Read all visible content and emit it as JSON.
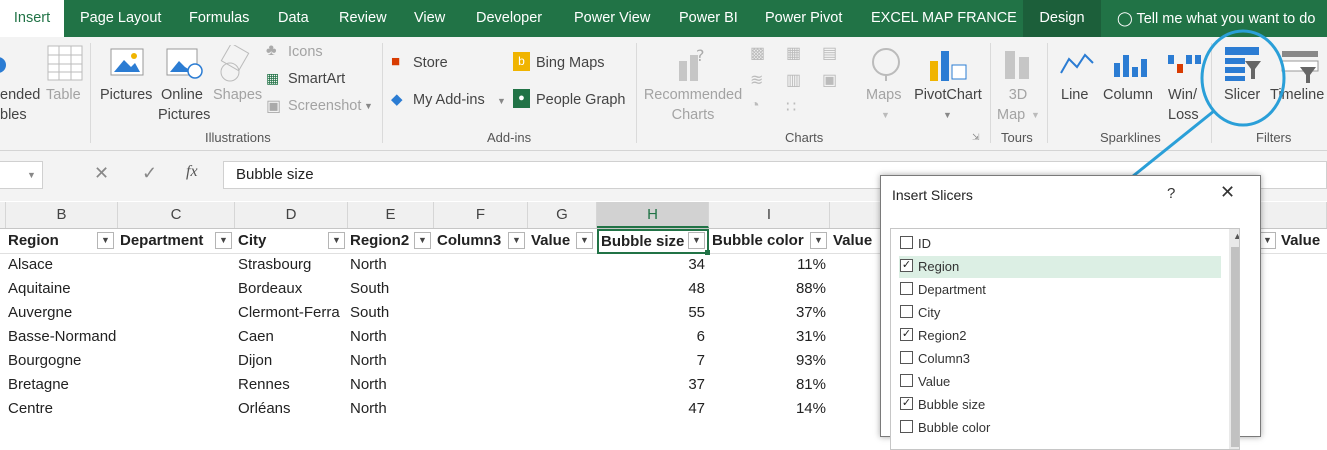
{
  "tabs": [
    "Insert",
    "Page Layout",
    "Formulas",
    "Data",
    "Review",
    "View",
    "Developer",
    "Power View",
    "Power BI",
    "Power Pivot",
    "EXCEL MAP FRANCE",
    "Design"
  ],
  "tell_me": "Tell me what you want to do",
  "ribbon": {
    "tables": {
      "recommended_pivot": "ended",
      "recommended_pivot2": "bles",
      "table": "Table"
    },
    "illustrations": {
      "pictures": "Pictures",
      "online": "Online",
      "pictures2": "Pictures",
      "shapes": "Shapes",
      "icons": "Icons",
      "smartart": "SmartArt",
      "screenshot": "Screenshot",
      "group": "Illustrations"
    },
    "addins": {
      "store": "Store",
      "my_addins": "My Add-ins",
      "bing_maps": "Bing Maps",
      "people_graph": "People Graph",
      "group": "Add-ins"
    },
    "charts": {
      "recommended": "Recommended",
      "charts_word": "Charts",
      "maps": "Maps",
      "pivotchart": "PivotChart",
      "group": "Charts"
    },
    "tours": {
      "map3d_a": "3D",
      "map3d_b": "Map",
      "group": "Tours"
    },
    "sparklines": {
      "line": "Line",
      "column": "Column",
      "winloss_a": "Win/",
      "winloss_b": "Loss",
      "group": "Sparklines"
    },
    "filters": {
      "slicer": "Slicer",
      "timeline": "Timeline",
      "group": "Filters"
    }
  },
  "formula_bar": {
    "fx": "fx",
    "content": "Bubble size"
  },
  "columns": [
    "B",
    "C",
    "D",
    "E",
    "F",
    "G",
    "H",
    "I"
  ],
  "headers": [
    "Region",
    "Department",
    "City",
    "Region2",
    "Column3",
    "Value",
    "Bubble size",
    "Bubble color",
    "Value"
  ],
  "headers_right": [
    "Value"
  ],
  "rows": [
    [
      "Alsace",
      "",
      "Strasbourg",
      "North",
      "",
      "",
      "34",
      "11%"
    ],
    [
      "Aquitaine",
      "",
      "Bordeaux",
      "South",
      "",
      "",
      "48",
      "88%"
    ],
    [
      "Auvergne",
      "",
      "Clermont-Ferra",
      "South",
      "",
      "",
      "55",
      "37%"
    ],
    [
      "Basse-Normandie",
      "",
      "Caen",
      "North",
      "",
      "",
      "6",
      "31%"
    ],
    [
      "Bourgogne",
      "",
      "Dijon",
      "North",
      "",
      "",
      "7",
      "93%"
    ],
    [
      "Bretagne",
      "",
      "Rennes",
      "North",
      "",
      "",
      "37",
      "81%"
    ],
    [
      "Centre",
      "",
      "Orléans",
      "North",
      "",
      "",
      "47",
      "14%"
    ]
  ],
  "dialog": {
    "title": "Insert Slicers",
    "help": "?",
    "items": [
      {
        "label": "ID",
        "checked": false
      },
      {
        "label": "Region",
        "checked": true
      },
      {
        "label": "Department",
        "checked": false
      },
      {
        "label": "City",
        "checked": false
      },
      {
        "label": "Region2",
        "checked": true
      },
      {
        "label": "Column3",
        "checked": false
      },
      {
        "label": "Value",
        "checked": false
      },
      {
        "label": "Bubble size",
        "checked": true
      },
      {
        "label": "Bubble color",
        "checked": false
      }
    ]
  },
  "colors": {
    "excel_green": "#217346",
    "annotation_blue": "#2a9fd8"
  }
}
